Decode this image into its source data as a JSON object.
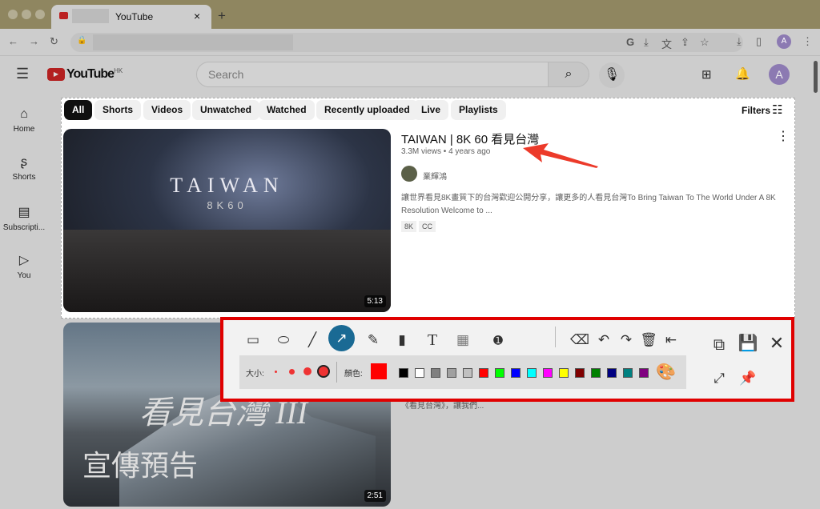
{
  "browser": {
    "tab_title": "YouTube",
    "new_tab": "+",
    "close_tab": "×",
    "profile": "A"
  },
  "youtube": {
    "logo": "YouTube",
    "region": "HK",
    "search_placeholder": "Search",
    "avatar": "A"
  },
  "sidebar": [
    {
      "icon": "⌂",
      "label": "Home"
    },
    {
      "icon": "ʂ",
      "label": "Shorts"
    },
    {
      "icon": "▤",
      "label": "Subscripti..."
    },
    {
      "icon": "▷",
      "label": "You"
    }
  ],
  "chips": [
    "All",
    "Shorts",
    "Videos",
    "Unwatched",
    "Watched",
    "Recently uploaded",
    "Live",
    "Playlists"
  ],
  "filters": "Filters",
  "video1": {
    "thumb_title": "TAIWAN",
    "thumb_sub": "8K60",
    "duration": "5:13",
    "title": "TAIWAN | 8K 60 看見台灣",
    "meta": "3.3M views • 4 years ago",
    "channel": "業輝鴻",
    "desc": "讓世界看見8K畫質下的台灣歡迎公開分享，讓更多的人看見台灣To Bring Taiwan To The World Under A 8K Resolution Welcome to ...",
    "badges": [
      "8K",
      "CC"
    ]
  },
  "video2": {
    "thumb_title": "看見台灣 III",
    "thumb_sub": "宣傳預告",
    "duration": "2:51",
    "desc": "《看見台灣》，讓我們..."
  },
  "annotator": {
    "size_label": "大小:",
    "color_label": "顏色:",
    "current_color": "#ff0000",
    "active_tool": "arrow",
    "palette": [
      "#000000",
      "#ffffff",
      "#808080",
      "#a0a0a0",
      "#c0c0c0",
      "#ff0000",
      "#00ff00",
      "#0000ff",
      "#00ffff",
      "#ff00ff",
      "#ffff00",
      "#800000",
      "#008000",
      "#000080",
      "#008080",
      "#800080"
    ],
    "accent": "#1a6a94"
  }
}
